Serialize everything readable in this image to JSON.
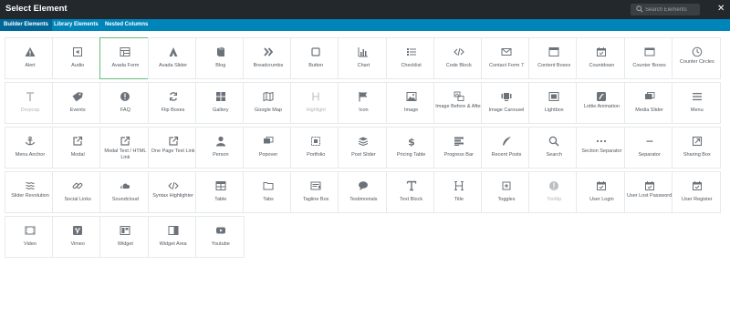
{
  "header": {
    "title": "Select Element",
    "search_placeholder": "Search Elements"
  },
  "tabs": [
    {
      "label": "Builder Elements",
      "active": true
    },
    {
      "label": "Library Elements",
      "active": false
    },
    {
      "label": "Nested Columns",
      "active": false
    }
  ],
  "colors": {
    "header_bg": "#23282d",
    "tabbar_bg": "#0085ba",
    "active_tab_bg": "#006799",
    "selected_border": "#65bc7b",
    "icon_color": "#6b7279"
  },
  "elements": [
    {
      "label": "Alert",
      "icon": "warning-icon"
    },
    {
      "label": "Audio",
      "icon": "audio-icon"
    },
    {
      "label": "Avada Form",
      "icon": "form-icon",
      "selected": true
    },
    {
      "label": "Avada Slider",
      "icon": "avada-icon"
    },
    {
      "label": "Blog",
      "icon": "book-icon"
    },
    {
      "label": "Breadcrumbs",
      "icon": "chevrons-right-icon"
    },
    {
      "label": "Button",
      "icon": "square-icon"
    },
    {
      "label": "Chart",
      "icon": "bar-chart-icon"
    },
    {
      "label": "Checklist",
      "icon": "checklist-icon"
    },
    {
      "label": "Code Block",
      "icon": "code-icon"
    },
    {
      "label": "Contact Form 7",
      "icon": "envelope-icon"
    },
    {
      "label": "Content Boxes",
      "icon": "content-boxes-icon"
    },
    {
      "label": "Countdown",
      "icon": "calendar-check-icon"
    },
    {
      "label": "Counter Boxes",
      "icon": "window-icon"
    },
    {
      "label": "Counter Circles",
      "icon": "clock-icon"
    },
    {
      "label": "Dropcap",
      "icon": "dropcap-icon",
      "disabled": true
    },
    {
      "label": "Events",
      "icon": "tag-icon"
    },
    {
      "label": "FAQ",
      "icon": "info-icon"
    },
    {
      "label": "Flip Boxes",
      "icon": "flip-icon"
    },
    {
      "label": "Gallery",
      "icon": "gallery-icon"
    },
    {
      "label": "Google Map",
      "icon": "map-icon"
    },
    {
      "label": "Highlight",
      "icon": "highlight-icon",
      "disabled": true
    },
    {
      "label": "Icon",
      "icon": "flag-icon"
    },
    {
      "label": "Image",
      "icon": "image-icon"
    },
    {
      "label": "Image Before & After",
      "icon": "before-after-icon"
    },
    {
      "label": "Image Carousel",
      "icon": "carousel-icon"
    },
    {
      "label": "Lightbox",
      "icon": "lightbox-icon"
    },
    {
      "label": "Lottie Animation",
      "icon": "lottie-icon"
    },
    {
      "label": "Media Slider",
      "icon": "media-slider-icon"
    },
    {
      "label": "Menu",
      "icon": "menu-icon"
    },
    {
      "label": "Menu Anchor",
      "icon": "anchor-icon"
    },
    {
      "label": "Modal",
      "icon": "external-link-icon"
    },
    {
      "label": "Modal Text / HTML Link",
      "icon": "external-link-icon"
    },
    {
      "label": "One Page Text Link",
      "icon": "external-link-icon"
    },
    {
      "label": "Person",
      "icon": "person-icon"
    },
    {
      "label": "Popover",
      "icon": "popover-icon"
    },
    {
      "label": "Portfolio",
      "icon": "portfolio-icon"
    },
    {
      "label": "Post Slider",
      "icon": "layers-icon"
    },
    {
      "label": "Pricing Table",
      "icon": "dollar-icon"
    },
    {
      "label": "Progress Bar",
      "icon": "progress-icon"
    },
    {
      "label": "Recent Posts",
      "icon": "quill-icon"
    },
    {
      "label": "Search",
      "icon": "search-icon"
    },
    {
      "label": "Section Separator",
      "icon": "dots-icon"
    },
    {
      "label": "Separator",
      "icon": "minus-icon"
    },
    {
      "label": "Sharing Box",
      "icon": "share-box-icon"
    },
    {
      "label": "Slider Revolution",
      "icon": "revolution-icon"
    },
    {
      "label": "Social Links",
      "icon": "link-icon"
    },
    {
      "label": "Soundcloud",
      "icon": "soundcloud-icon"
    },
    {
      "label": "Syntax Highlighter",
      "icon": "code-icon"
    },
    {
      "label": "Table",
      "icon": "table-icon"
    },
    {
      "label": "Tabs",
      "icon": "folder-icon"
    },
    {
      "label": "Tagline Box",
      "icon": "tagline-icon"
    },
    {
      "label": "Testimonials",
      "icon": "speech-icon"
    },
    {
      "label": "Text Block",
      "icon": "text-icon"
    },
    {
      "label": "Title",
      "icon": "heading-icon"
    },
    {
      "label": "Toggles",
      "icon": "plus-box-icon"
    },
    {
      "label": "Tooltip",
      "icon": "tooltip-icon",
      "disabled": true
    },
    {
      "label": "User Login",
      "icon": "calendar-check-icon"
    },
    {
      "label": "User Lost Password",
      "icon": "calendar-check-icon"
    },
    {
      "label": "User Register",
      "icon": "calendar-check-icon"
    },
    {
      "label": "Video",
      "icon": "video-icon"
    },
    {
      "label": "Vimeo",
      "icon": "vimeo-icon"
    },
    {
      "label": "Widget",
      "icon": "widget-icon"
    },
    {
      "label": "Widget Area",
      "icon": "widget-area-icon"
    },
    {
      "label": "Youtube",
      "icon": "youtube-icon"
    }
  ]
}
